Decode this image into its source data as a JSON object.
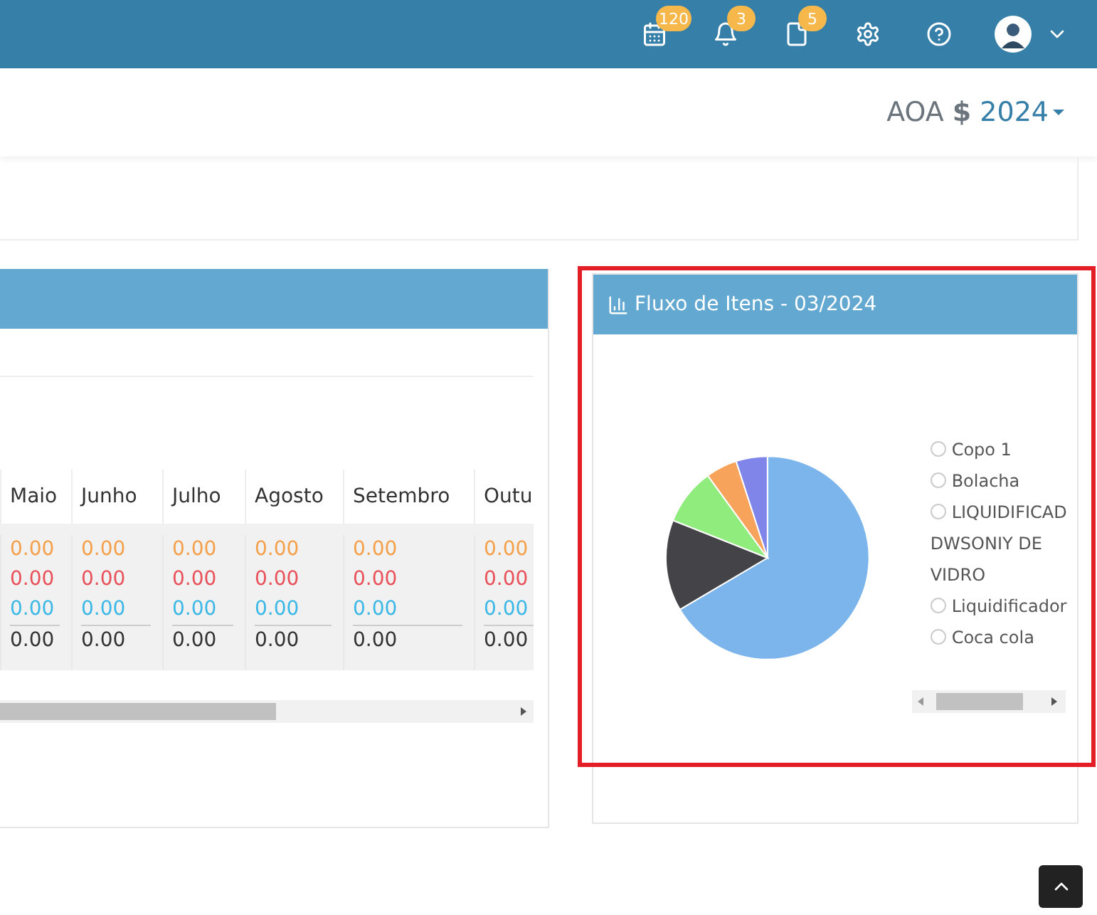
{
  "topbar": {
    "badges": [
      {
        "kind": "calendar",
        "count": "120"
      },
      {
        "kind": "bell",
        "count": "3"
      },
      {
        "kind": "document",
        "count": "5"
      }
    ]
  },
  "period": {
    "currency": "AOA",
    "symbol": "$",
    "year": "2024"
  },
  "table": {
    "columns": [
      "Maio",
      "Junho",
      "Julho",
      "Agosto",
      "Setembro",
      "Outu"
    ],
    "rows": [
      {
        "kind": "value",
        "color": "#f5a04a",
        "cells": [
          "0.00",
          "0.00",
          "0.00",
          "0.00",
          "0.00",
          "0.00"
        ]
      },
      {
        "kind": "value",
        "color": "#e9515b",
        "cells": [
          "0.00",
          "0.00",
          "0.00",
          "0.00",
          "0.00",
          "0.00"
        ]
      },
      {
        "kind": "value",
        "color": "#3bb8e6",
        "cells": [
          "0.00",
          "0.00",
          "0.00",
          "0.00",
          "0.00",
          "0.00"
        ]
      },
      {
        "kind": "total",
        "color": "#333333",
        "cells": [
          "0.00",
          "0.00",
          "0.00",
          "0.00",
          "0.00",
          "0.00"
        ]
      }
    ]
  },
  "chart_card": {
    "title": "Fluxo de Itens - 03/2024",
    "legend": [
      "Copo 1",
      "Bolacha",
      "LIQUIDIFICAD DWSONIY DE VIDRO",
      "Liquidificador",
      "Coca cola"
    ]
  }
}
